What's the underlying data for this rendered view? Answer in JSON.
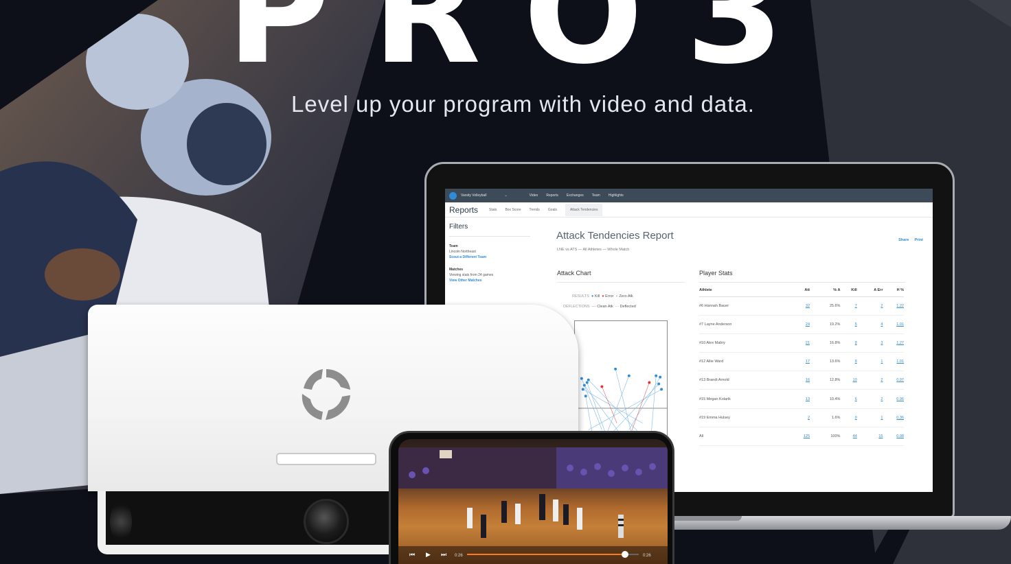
{
  "hero": {
    "title": "PRO3",
    "tagline": "Level up your program with video and data."
  },
  "app": {
    "team_select": "Varsity Volleyball",
    "nav_items": [
      "Video",
      "Reports",
      "Exchanges",
      "Team",
      "Highlights"
    ],
    "section_title": "Reports",
    "tabs": [
      "Stats",
      "Box Score",
      "Trends",
      "Goals",
      "Attack Tendencies"
    ],
    "active_tab": "Attack Tendencies",
    "filters": {
      "heading": "Filters",
      "team_label": "Team",
      "team_value": "Lincoln Northeast",
      "team_link": "Scout a Different Team",
      "matches_label": "Matches",
      "matches_value": "Viewing stats from 24 games",
      "matches_link": "View Other Matches"
    },
    "report": {
      "title": "Attack Tendencies Report",
      "subtitle": "LNE vs ATS — All Athletes — Whole Match",
      "share": "Share",
      "print": "Print"
    },
    "attack_chart": {
      "heading": "Attack Chart",
      "results_label": "RESULTS",
      "results": [
        "Kill",
        "Error",
        "Zero Atk"
      ],
      "deflections_label": "DEFLECTIONS",
      "deflections": [
        "Clean Atk",
        "Deflected"
      ]
    },
    "player_stats": {
      "heading": "Player Stats",
      "columns": [
        "Athlete",
        "Att",
        "% A",
        "Kill",
        "A Err",
        "H %"
      ],
      "rows": [
        [
          "#6 Hannah Bauer",
          "32",
          "25.6%",
          "7",
          "2",
          "1.22"
        ],
        [
          "#7 Layne Anderson",
          "24",
          "19.2%",
          "5",
          "4",
          "1.01"
        ],
        [
          "#10 Alex Mabry",
          "21",
          "16.8%",
          "8",
          "3",
          "1.27"
        ],
        [
          "#12 Allie Ward",
          "17",
          "13.6%",
          "8",
          "1",
          "1.01"
        ],
        [
          "#13 Brandi Arnold",
          "16",
          "12.8%",
          "10",
          "2",
          "0.97"
        ],
        [
          "#15 Megan Kolarik",
          "13",
          "10.4%",
          "6",
          "2",
          "0.96"
        ],
        [
          "#19 Emma Hulsey",
          "2",
          "1.6%",
          "0",
          "1",
          "0.36"
        ],
        [
          "All",
          "125",
          "100%",
          "44",
          "15",
          "0.98"
        ]
      ]
    }
  },
  "phone_video": {
    "time_current": "0:26",
    "time_total": "0:26",
    "progress": 0.92
  },
  "colors": {
    "background": "#0d1019",
    "stripe": "#2e3139",
    "accent_blue": "#2f8bd8",
    "accent_orange": "#ff7a1a"
  }
}
